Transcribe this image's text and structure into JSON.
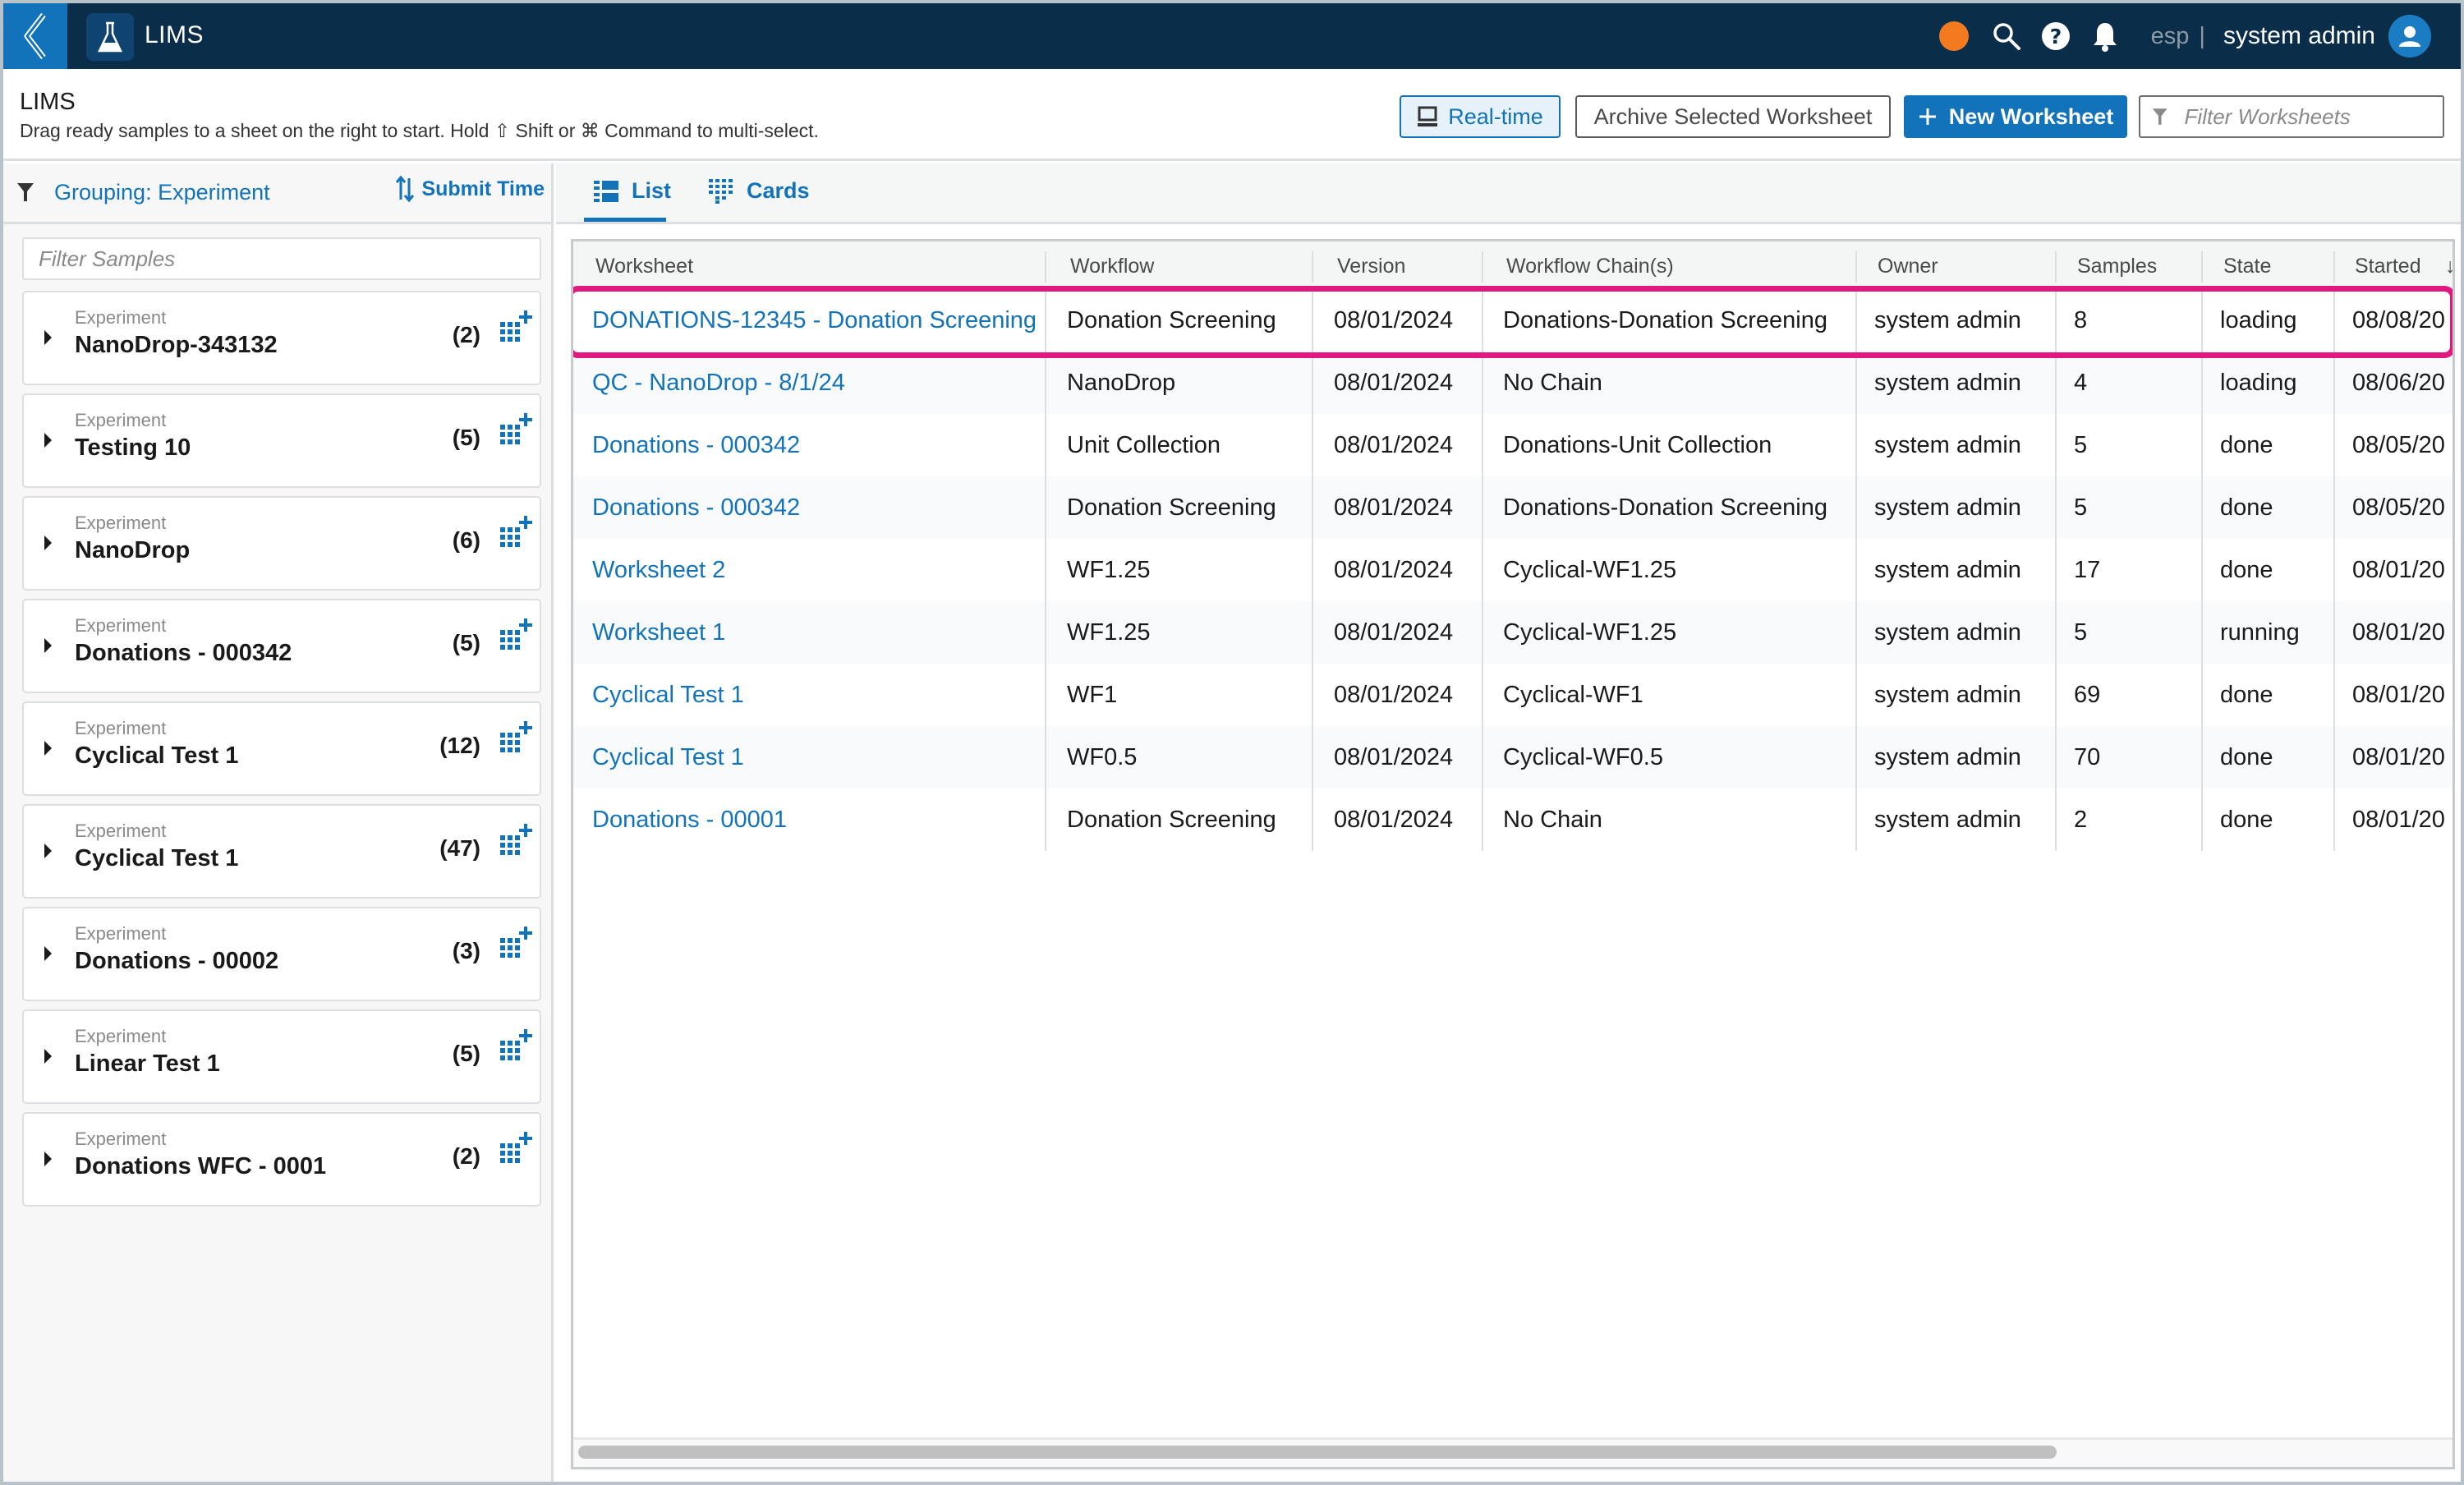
{
  "topbar": {
    "app_title": "LIMS",
    "back_icon": "chevron-left-icon",
    "app_icon": "flask-icon",
    "status_color": "#f47a20",
    "icons": [
      "status-dot",
      "search-icon",
      "help-icon",
      "bell-icon"
    ],
    "tenant": "esp",
    "separator": "|",
    "user_name": "system admin",
    "avatar_icon": "user-icon"
  },
  "page": {
    "title": "LIMS",
    "subtitle": "Drag ready samples to a sheet on the right to start. Hold ⇧ Shift or ⌘ Command to multi-select.",
    "buttons": {
      "realtime": "Real-time",
      "archive": "Archive Selected Worksheet",
      "new_worksheet": "New Worksheet"
    },
    "filter_worksheets_placeholder": "Filter Worksheets"
  },
  "sidebar": {
    "grouping_label": "Grouping: Experiment",
    "sort_label": "Submit Time",
    "filter_samples_placeholder": "Filter Samples",
    "groups": [
      {
        "kind": "Experiment",
        "name": "NanoDrop-343132",
        "count": "(2)"
      },
      {
        "kind": "Experiment",
        "name": "Testing 10",
        "count": "(5)"
      },
      {
        "kind": "Experiment",
        "name": "NanoDrop",
        "count": "(6)"
      },
      {
        "kind": "Experiment",
        "name": "Donations - 000342",
        "count": "(5)"
      },
      {
        "kind": "Experiment",
        "name": "Cyclical Test 1",
        "count": "(12)"
      },
      {
        "kind": "Experiment",
        "name": "Cyclical Test 1",
        "count": "(47)"
      },
      {
        "kind": "Experiment",
        "name": "Donations - 00002",
        "count": "(3)"
      },
      {
        "kind": "Experiment",
        "name": "Linear Test 1",
        "count": "(5)"
      },
      {
        "kind": "Experiment",
        "name": "Donations WFC - 0001",
        "count": "(2)"
      }
    ]
  },
  "main": {
    "tabs": [
      {
        "label": "List",
        "icon": "list-view-icon",
        "active": true
      },
      {
        "label": "Cards",
        "icon": "cards-view-icon",
        "active": false
      }
    ],
    "table": {
      "columns": [
        "Worksheet",
        "Workflow",
        "Version",
        "Workflow Chain(s)",
        "Owner",
        "Samples",
        "State",
        "Started"
      ],
      "sort_indicator": "↓",
      "highlight_color": "#e0187f",
      "rows": [
        {
          "worksheet": "DONATIONS-12345 - Donation Screening",
          "workflow": "Donation Screening",
          "version": "08/01/2024",
          "chain": "Donations-Donation Screening",
          "owner": "system admin",
          "samples": "8",
          "state": "loading",
          "started": "08/08/20"
        },
        {
          "worksheet": "QC - NanoDrop - 8/1/24",
          "workflow": "NanoDrop",
          "version": "08/01/2024",
          "chain": "No Chain",
          "owner": "system admin",
          "samples": "4",
          "state": "loading",
          "started": "08/06/20"
        },
        {
          "worksheet": "Donations - 000342",
          "workflow": "Unit Collection",
          "version": "08/01/2024",
          "chain": "Donations-Unit Collection",
          "owner": "system admin",
          "samples": "5",
          "state": "done",
          "started": "08/05/20"
        },
        {
          "worksheet": "Donations - 000342",
          "workflow": "Donation Screening",
          "version": "08/01/2024",
          "chain": "Donations-Donation Screening",
          "owner": "system admin",
          "samples": "5",
          "state": "done",
          "started": "08/05/20"
        },
        {
          "worksheet": "Worksheet 2",
          "workflow": "WF1.25",
          "version": "08/01/2024",
          "chain": "Cyclical-WF1.25",
          "owner": "system admin",
          "samples": "17",
          "state": "done",
          "started": "08/01/20"
        },
        {
          "worksheet": "Worksheet 1",
          "workflow": "WF1.25",
          "version": "08/01/2024",
          "chain": "Cyclical-WF1.25",
          "owner": "system admin",
          "samples": "5",
          "state": "running",
          "started": "08/01/20"
        },
        {
          "worksheet": "Cyclical Test 1",
          "workflow": "WF1",
          "version": "08/01/2024",
          "chain": "Cyclical-WF1",
          "owner": "system admin",
          "samples": "69",
          "state": "done",
          "started": "08/01/20"
        },
        {
          "worksheet": "Cyclical Test 1",
          "workflow": "WF0.5",
          "version": "08/01/2024",
          "chain": "Cyclical-WF0.5",
          "owner": "system admin",
          "samples": "70",
          "state": "done",
          "started": "08/01/20"
        },
        {
          "worksheet": "Donations - 00001",
          "workflow": "Donation Screening",
          "version": "08/01/2024",
          "chain": "No Chain",
          "owner": "system admin",
          "samples": "2",
          "state": "done",
          "started": "08/01/20"
        }
      ]
    }
  },
  "colors": {
    "brand_dark": "#0a2d4a",
    "brand_blue": "#1273ba",
    "highlight": "#e0187f",
    "status": "#f47a20"
  }
}
